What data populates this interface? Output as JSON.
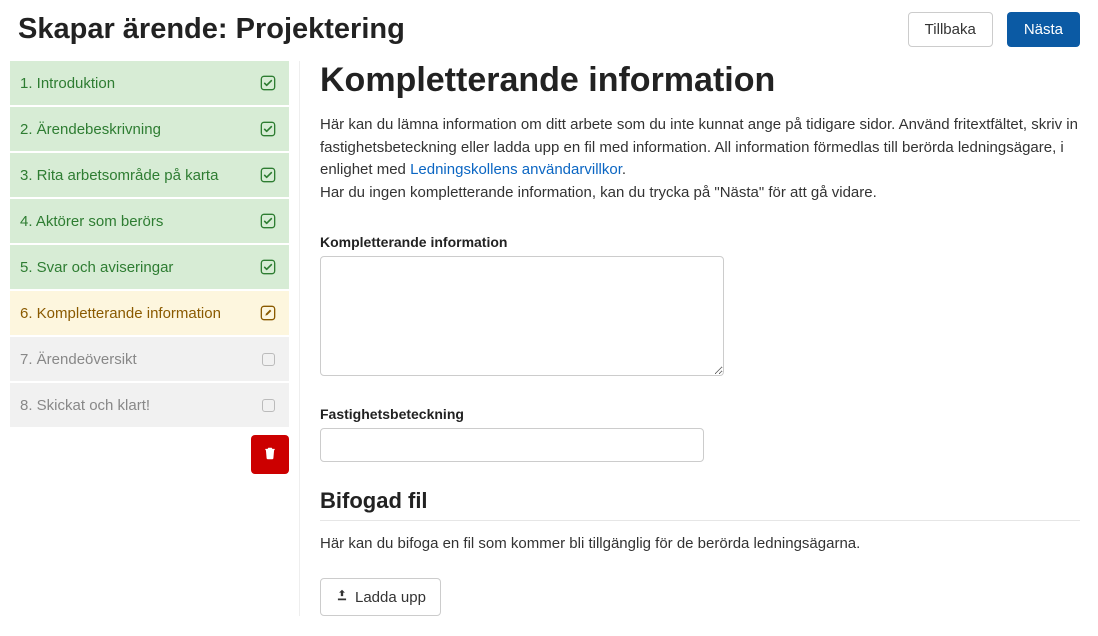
{
  "header": {
    "title": "Skapar ärende: Projektering",
    "back_label": "Tillbaka",
    "next_label": "Nästa"
  },
  "sidebar": {
    "steps": [
      {
        "label": "1. Introduktion",
        "status": "done"
      },
      {
        "label": "2. Ärendebeskrivning",
        "status": "done"
      },
      {
        "label": "3. Rita arbetsområde på karta",
        "status": "done"
      },
      {
        "label": "4. Aktörer som berörs",
        "status": "done"
      },
      {
        "label": "5. Svar och aviseringar",
        "status": "done"
      },
      {
        "label": "6. Kompletterande information",
        "status": "current"
      },
      {
        "label": "7. Ärendeöversikt",
        "status": "upcoming"
      },
      {
        "label": "8. Skickat och klart!",
        "status": "upcoming"
      }
    ]
  },
  "main": {
    "heading": "Kompletterande information",
    "intro_part1": "Här kan du lämna information om ditt arbete som du inte kunnat ange på tidigare sidor. Använd fritextfältet, skriv in fastighetsbeteckning eller ladda upp en fil med information. All information förmedlas till berörda ledningsägare, i enlighet med ",
    "intro_link": "Ledningskollens användarvillkor",
    "intro_part1_end": ".",
    "intro_part2": "Har du ingen kompletterande information, kan du trycka på \"Nästa\" för att gå vidare.",
    "label_info": "Kompletterande information",
    "info_value": "",
    "label_fastighet": "Fastighetsbeteckning",
    "fastighet_value": "",
    "bifog_title": "Bifogad fil",
    "bifog_desc": "Här kan du bifoga en fil som kommer bli tillgänglig för de berörda ledningsägarna.",
    "upload_label": "Ladda upp"
  }
}
